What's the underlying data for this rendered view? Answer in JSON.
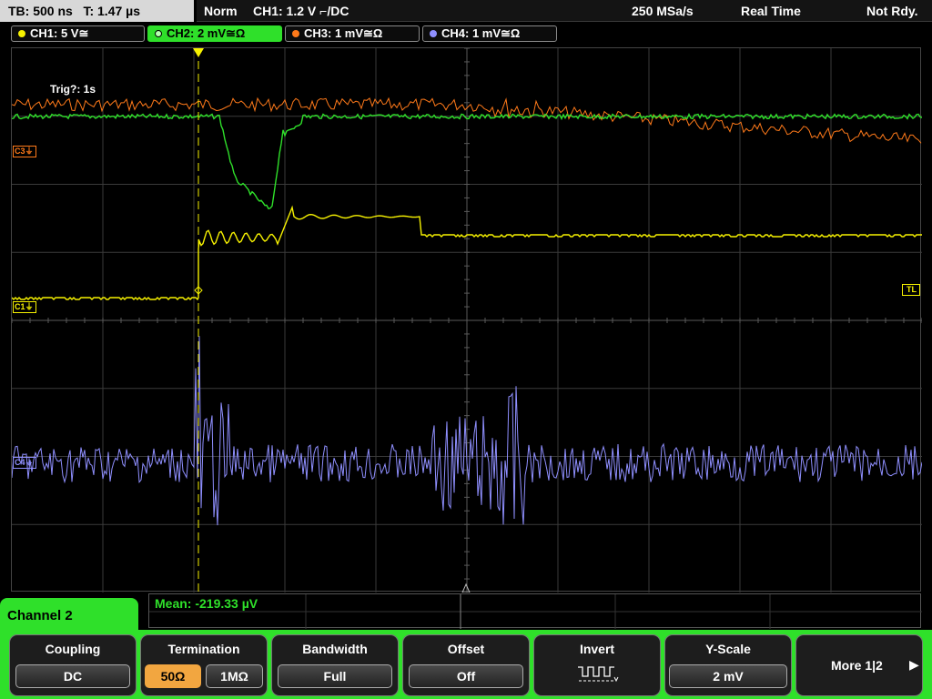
{
  "status_bar": {
    "timebase": "TB: 500 ns   T: 1.47 µs",
    "trigger_mode": "Norm",
    "trigger_info": "CH1: 1.2 V ⌐/DC",
    "sample_rate": "250 MSa/s",
    "acq_mode": "Real Time",
    "state": "Not Rdy."
  },
  "channel_tabs": [
    {
      "label": "CH1: 5 V≅",
      "color": "#f7f200",
      "active": false
    },
    {
      "label": "CH2: 2 mV≅Ω",
      "color": "#2fe02a",
      "active": true
    },
    {
      "label": "CH3: 1 mV≅Ω",
      "color": "#ff7a1a",
      "active": false
    },
    {
      "label": "CH4: 1 mV≅Ω",
      "color": "#8f8fff",
      "active": false
    }
  ],
  "display": {
    "trigger_status": "Trig?: 1s",
    "marker_c3": "C3",
    "marker_c1": "C1",
    "marker_c4": "C4",
    "trigger_level_label": "TL"
  },
  "measurement": {
    "mean": "Mean: -219.33 µV"
  },
  "active_channel": "Channel 2",
  "softkeys": {
    "coupling": {
      "title": "Coupling",
      "value": "DC"
    },
    "termination": {
      "title": "Termination",
      "options": [
        "50Ω",
        "1MΩ"
      ],
      "selected": "50Ω"
    },
    "bandwidth": {
      "title": "Bandwidth",
      "value": "Full"
    },
    "offset": {
      "title": "Offset",
      "value": "Off"
    },
    "invert": {
      "title": "Invert",
      "icon": "square-wave-invert-icon"
    },
    "yscale": {
      "title": "Y-Scale",
      "value": "2 mV"
    },
    "more": {
      "label": "More 1|2"
    }
  },
  "colors": {
    "ch1": "#f7f200",
    "ch2": "#2fe02a",
    "ch3": "#ff7a1a",
    "ch4": "#8f8fff",
    "accent": "#2fe02a"
  }
}
